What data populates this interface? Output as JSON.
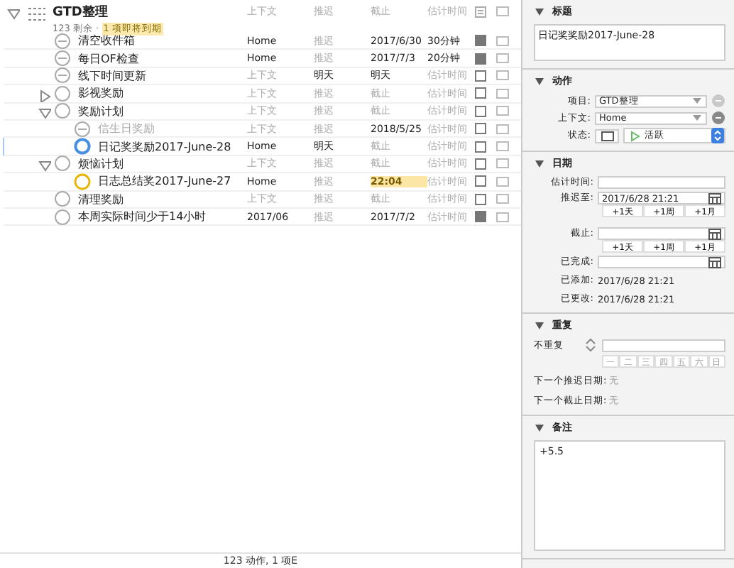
{
  "project": {
    "title": "GTD整理",
    "count": "123 剩余 ·",
    "badge": "1 项即将到期",
    "expanded": true,
    "columns": [
      "上下文",
      "推迟",
      "截止",
      "估计时间"
    ]
  },
  "rows": [
    {
      "title": "清空收件箱",
      "kind": "repeat",
      "selected": false,
      "dimmed": false,
      "flagged": true,
      "cells": [
        {
          "text": "Home",
          "empty": false
        },
        {
          "text": "推迟",
          "empty": true
        },
        {
          "text": "2017/6/30",
          "empty": false,
          "due_soon": false
        },
        {
          "text": "30分钟",
          "empty": false
        }
      ]
    },
    {
      "title": "每日OF检查",
      "kind": "repeat",
      "selected": false,
      "dimmed": false,
      "flagged": true,
      "cells": [
        {
          "text": "Home",
          "empty": false
        },
        {
          "text": "推迟",
          "empty": true
        },
        {
          "text": "2017/7/3",
          "empty": false,
          "due_soon": false
        },
        {
          "text": "20分钟",
          "empty": false
        }
      ]
    },
    {
      "title": "线下时间更新",
      "kind": "repeat",
      "selected": false,
      "dimmed": false,
      "flagged": false,
      "cells": [
        {
          "text": "上下文",
          "empty": true
        },
        {
          "text": "明天",
          "empty": false
        },
        {
          "text": "明天",
          "empty": false,
          "due_soon": false
        },
        {
          "text": "估计时间",
          "empty": true
        }
      ]
    },
    {
      "title": "影视奖励",
      "kind": "plain",
      "selected": false,
      "dimmed": false,
      "flagged": false,
      "expanded": false,
      "cells": [
        {
          "text": "上下文",
          "empty": true
        },
        {
          "text": "推迟",
          "empty": true
        },
        {
          "text": "截止",
          "empty": true,
          "due_soon": false
        },
        {
          "text": "估计时间",
          "empty": true
        }
      ]
    },
    {
      "title": "奖励计划",
      "kind": "plain",
      "selected": false,
      "dimmed": false,
      "flagged": false,
      "expanded": true,
      "cells": [
        {
          "text": "上下文",
          "empty": true
        },
        {
          "text": "推迟",
          "empty": true
        },
        {
          "text": "截止",
          "empty": true,
          "due_soon": false
        },
        {
          "text": "估计时间",
          "empty": true
        }
      ],
      "children": [
        {
          "title": "信生日奖励",
          "kind": "repeat",
          "selected": false,
          "dimmed": true,
          "flagged": false,
          "cells": [
            {
              "text": "上下文",
              "empty": true
            },
            {
              "text": "推迟",
              "empty": true
            },
            {
              "text": "2018/5/25",
              "empty": false,
              "due_soon": false
            },
            {
              "text": "估计时间",
              "empty": true
            }
          ]
        },
        {
          "title": "日记奖奖励2017-June-28",
          "kind": "active",
          "selected": true,
          "dimmed": false,
          "flagged": false,
          "cells": [
            {
              "text": "Home",
              "empty": false
            },
            {
              "text": "明天",
              "empty": false
            },
            {
              "text": "截止",
              "empty": true,
              "due_soon": false
            },
            {
              "text": "估计时间",
              "empty": true
            }
          ]
        }
      ]
    },
    {
      "title": "烦恼计划",
      "kind": "plain",
      "selected": false,
      "dimmed": false,
      "flagged": false,
      "expanded": true,
      "cells": [
        {
          "text": "上下文",
          "empty": true
        },
        {
          "text": "推迟",
          "empty": true
        },
        {
          "text": "截止",
          "empty": true,
          "due_soon": false
        },
        {
          "text": "估计时间",
          "empty": true
        }
      ],
      "children": [
        {
          "title": "日志总结奖2017-June-27",
          "kind": "due",
          "selected": false,
          "dimmed": false,
          "flagged": false,
          "cells": [
            {
              "text": "Home",
              "empty": false
            },
            {
              "text": "推迟",
              "empty": true
            },
            {
              "text": "22:04",
              "empty": false,
              "due_soon": true
            },
            {
              "text": "估计时间",
              "empty": true
            }
          ]
        }
      ]
    },
    {
      "title": "清理奖励",
      "kind": "plain",
      "selected": false,
      "dimmed": false,
      "flagged": false,
      "cells": [
        {
          "text": "上下文",
          "empty": true
        },
        {
          "text": "推迟",
          "empty": true
        },
        {
          "text": "截止",
          "empty": true,
          "due_soon": false
        },
        {
          "text": "估计时间",
          "empty": true
        }
      ]
    },
    {
      "title": "本周实际时间少于14小时",
      "kind": "plain",
      "selected": false,
      "dimmed": false,
      "flagged": true,
      "cells": [
        {
          "text": "2017/06",
          "empty": false
        },
        {
          "text": "推迟",
          "empty": true
        },
        {
          "text": "2017/7/2",
          "empty": false,
          "due_soon": false
        },
        {
          "text": "估计时间",
          "empty": true
        }
      ]
    }
  ],
  "status_bar": "123 动作, 1 项E",
  "inspector": {
    "title_section": {
      "heading": "标题",
      "value": "日记奖奖励2017-June-28"
    },
    "action_section": {
      "heading": "动作",
      "project_label": "项目:",
      "project": "GTD整理",
      "context_label": "上下文:",
      "context": "Home",
      "status_label": "状态:",
      "status": "活跃"
    },
    "dates_section": {
      "heading": "日期",
      "estimate_label": "估计时间:",
      "defer_label": "推迟至:",
      "defer": "2017/6/28 21:21",
      "defer_quick": [
        "+1天",
        "+1周",
        "+1月"
      ],
      "due_label": "截止:",
      "due_quick": [
        "+1天",
        "+1周",
        "+1月"
      ],
      "completed_label": "已完成:",
      "added_label": "已添加:",
      "added": "2017/6/28 21:21",
      "changed_label": "已更改:",
      "changed": "2017/6/28 21:21"
    },
    "repeat_section": {
      "heading": "重复",
      "mode": "不重复",
      "weekdays": [
        "一",
        "二",
        "三",
        "四",
        "五",
        "六",
        "日"
      ],
      "next_defer_label": "下一个推迟日期:",
      "next_defer": "无",
      "next_due_label": "下一个截止日期:",
      "next_due": "无"
    },
    "note_section": {
      "heading": "备注",
      "value": "+5.5"
    }
  }
}
